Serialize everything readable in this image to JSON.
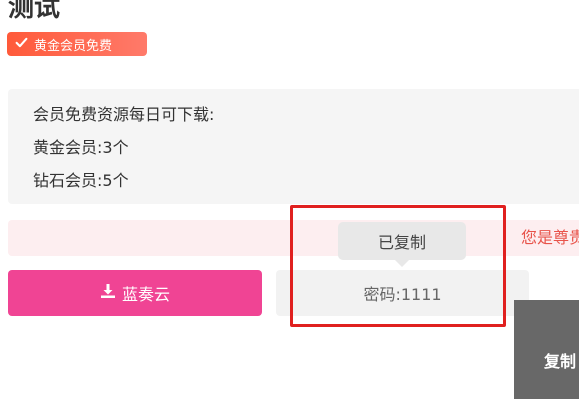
{
  "page": {
    "title": "测试"
  },
  "badge": {
    "label": "黄金会员免费",
    "icon": "check-icon"
  },
  "info": {
    "line1": "会员免费资源每日可下载:",
    "line2": "黄金会员:3个",
    "line3": "钻石会员:5个"
  },
  "notice": {
    "text": "您是尊贵"
  },
  "buttons": {
    "lanzou_label": "蓝奏云",
    "lanzou_icon": "download-icon",
    "password_label": "密码:1111"
  },
  "tooltip": {
    "text": "已复制"
  },
  "side_panel": {
    "label": "复制"
  },
  "colors": {
    "badge": "#ff5a3a",
    "lanzou_button": "#f04494",
    "notice_bg": "#fdeef0",
    "notice_text": "#e8534a",
    "highlight": "#e0201f"
  }
}
